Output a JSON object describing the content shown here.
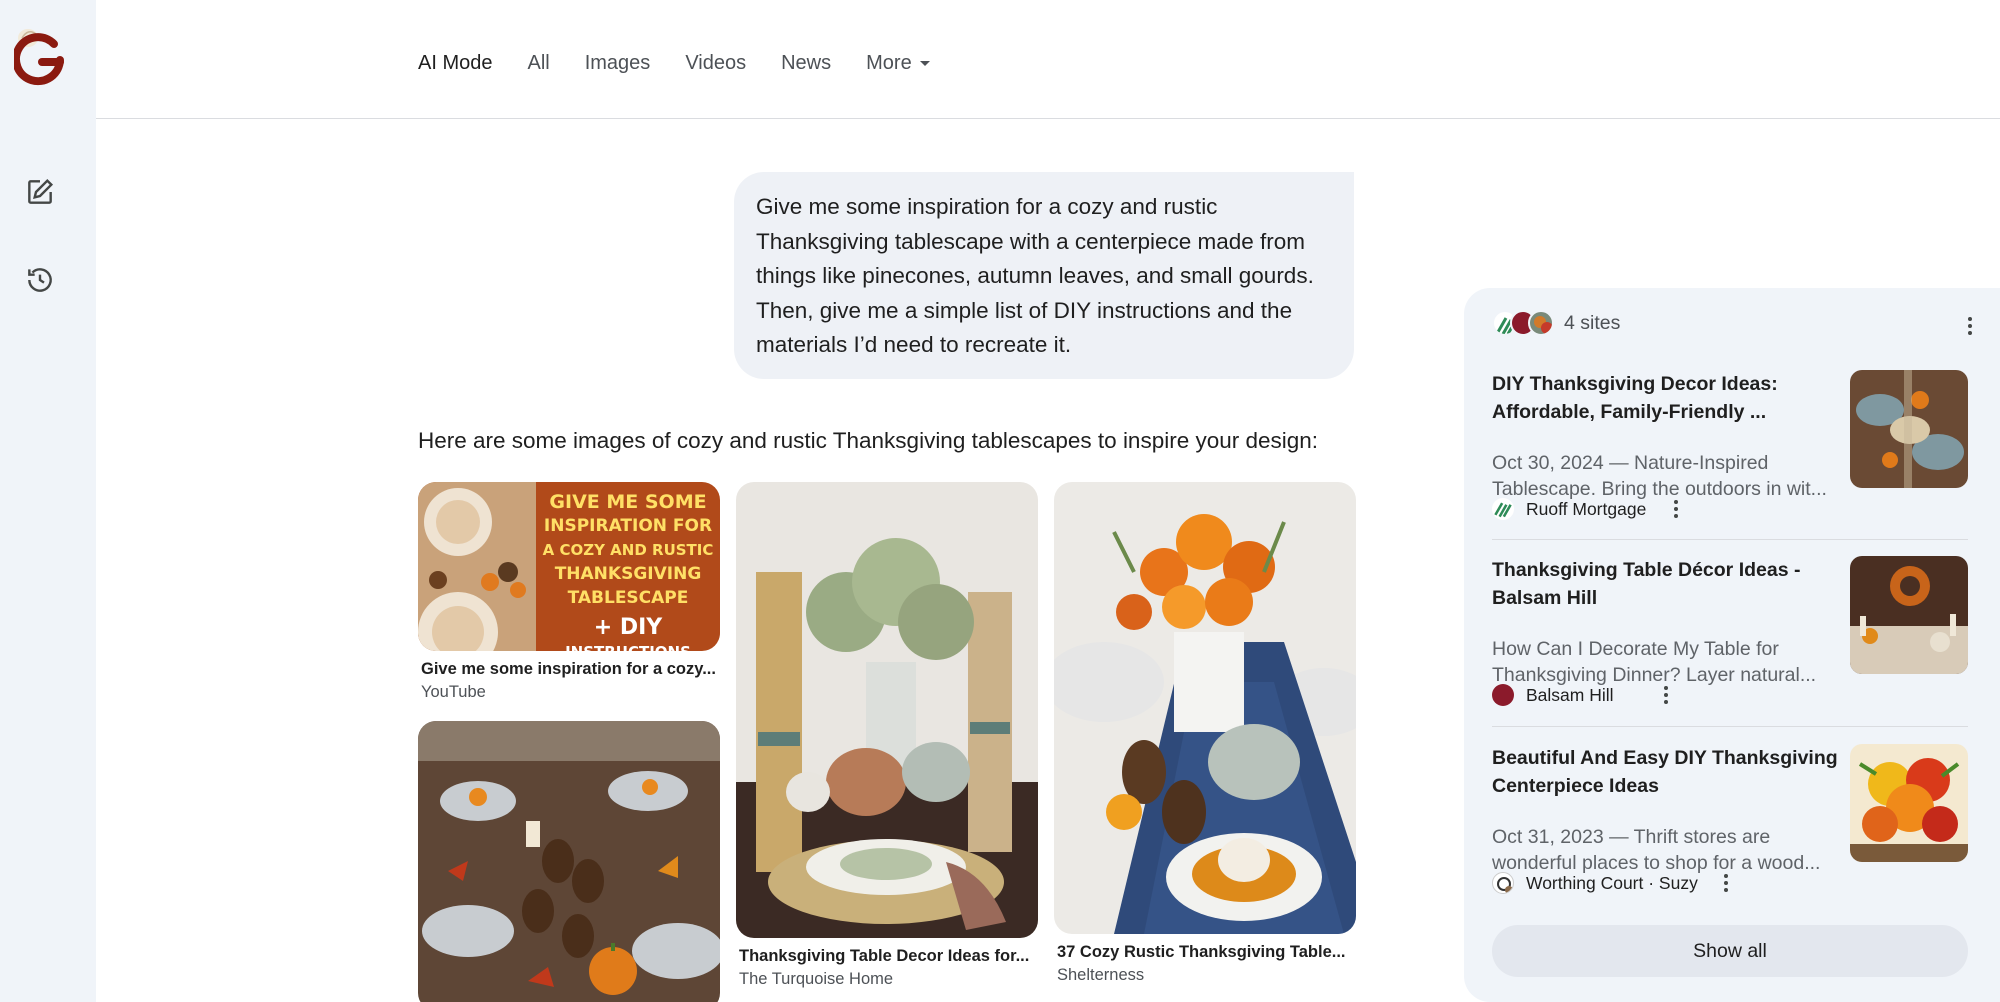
{
  "nav": {
    "tabs": [
      {
        "label": "AI Mode",
        "active": true
      },
      {
        "label": "All"
      },
      {
        "label": "Images"
      },
      {
        "label": "Videos"
      },
      {
        "label": "News"
      },
      {
        "label": "More"
      }
    ]
  },
  "rail": {
    "icons": [
      "google-logo",
      "new-chat-icon",
      "history-icon"
    ]
  },
  "query": {
    "text": "Give me some inspiration for a cozy and rustic Thanksgiving tablescape with a centerpiece made from things like pinecones, autumn leaves, and small gourds. Then, give me a simple list of DIY instructions and the materials I’d need to recreate it."
  },
  "answer": {
    "intro": "Here are some images of cozy and rustic Thanksgiving tablescapes to inspire your design:"
  },
  "images": [
    {
      "title": "Give me some inspiration for a cozy...",
      "source": "YouTube",
      "thumb_text": [
        "GIVE ME SOME",
        "INSPIRATION FOR",
        "A COZY AND RUSTIC",
        "THANKSGIVING",
        "TABLESCAPE",
        "+ DIY",
        "INSTRUCTIONS"
      ]
    },
    {
      "title": "Thanksgiving Table Decor Ideas for...",
      "source": "The Turquoise Home"
    },
    {
      "title": "37 Cozy Rustic Thanksgiving Table...",
      "source": "Shelterness"
    },
    {
      "title": "",
      "source": ""
    }
  ],
  "sources": {
    "count_label": "4 sites",
    "items": [
      {
        "title": "DIY Thanksgiving Decor Ideas: Affordable, Family-Friendly ...",
        "snippet": "Oct 30, 2024 — Nature-Inspired Tablescape. Bring the outdoors in wit...",
        "site": "Ruoff Mortgage"
      },
      {
        "title": "Thanksgiving Table Décor Ideas - Balsam Hill",
        "snippet": "How Can I Decorate My Table for Thanksgiving Dinner? Layer natural...",
        "site": "Balsam Hill"
      },
      {
        "title": "Beautiful And Easy DIY Thanksgiving Centerpiece Ideas",
        "snippet": "Oct 31, 2023 — Thrift stores are wonderful places to shop for a wood...",
        "site": "Worthing Court · Suzy"
      }
    ],
    "show_all": "Show all"
  },
  "colors": {
    "rail_bg": "#f0f4f9",
    "bubble_bg": "#eef1f6",
    "logo_red": "#8b1a10",
    "ruoff_green": "#2e8b57",
    "balsam_red": "#8b1a2b"
  }
}
